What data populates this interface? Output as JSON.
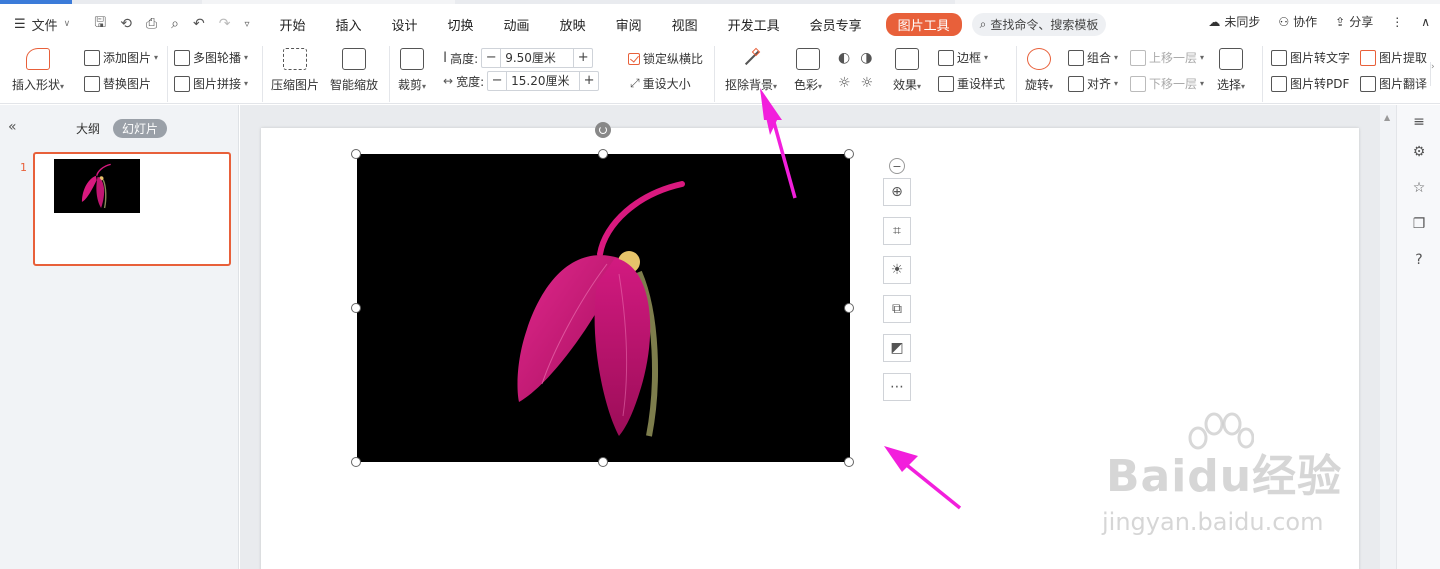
{
  "menubar": {
    "file_label": "文件",
    "tabs": [
      "开始",
      "插入",
      "设计",
      "切换",
      "动画",
      "放映",
      "审阅",
      "视图",
      "开发工具",
      "会员专享"
    ],
    "active_tab": "图片工具",
    "search_placeholder": "查找命令、搜索模板",
    "sync": "未同步",
    "collab": "协作",
    "share": "分享"
  },
  "ribbon": {
    "insert_shape": "插入形状",
    "add_picture": "添加图片",
    "replace_picture": "替换图片",
    "multi_carousel": "多图轮播",
    "picture_collage": "图片拼接",
    "compress": "压缩图片",
    "smart_scale": "智能缩放",
    "crop": "裁剪",
    "height_label": "高度:",
    "height_value": "9.50厘米",
    "width_label": "宽度:",
    "width_value": "15.20厘米",
    "lock_ratio": "锁定纵横比",
    "reset_size": "重设大小",
    "remove_bg": "抠除背景",
    "color": "色彩",
    "effects": "效果",
    "border": "边框",
    "reset_style": "重设样式",
    "rotate": "旋转",
    "group": "组合",
    "align": "对齐",
    "bring_forward": "上移一层",
    "send_backward": "下移一层",
    "select": "选择",
    "pic_to_text": "图片转文字",
    "pic_to_pdf": "图片转PDF",
    "pic_extract": "图片提取",
    "pic_translate": "图片翻译"
  },
  "leftpanel": {
    "outline_tab": "大纲",
    "slides_tab": "幻灯片",
    "slide_number": "1"
  },
  "colors": {
    "accent": "#e8603a",
    "annotation_arrow": "#f21fdc",
    "flower": "#d9197f"
  },
  "watermark": {
    "logo": "Baidu经验",
    "url": "jingyan.baidu.com"
  }
}
